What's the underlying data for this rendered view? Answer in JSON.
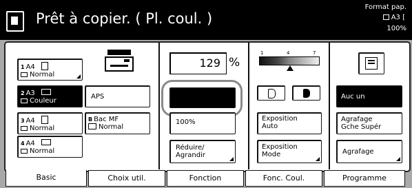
{
  "header": {
    "title": "Prêt à copier. ( Pl. coul.   )",
    "format_label": "Format pap.",
    "format_size": "A3  [",
    "zoom": "100%"
  },
  "paper": [
    {
      "num": "1",
      "size": "A4",
      "type": "Normal"
    },
    {
      "num": "2",
      "size": "A3",
      "type": "Couleur"
    },
    {
      "num": "3",
      "size": "A4",
      "type": "Normal"
    },
    {
      "num": "4",
      "size": "A4",
      "type": "Normal"
    }
  ],
  "aps_label": "APS",
  "bypass": {
    "num": "B",
    "label": "Bac MF",
    "type": "Normal"
  },
  "zoom_panel": {
    "value": "129",
    "unit": "%",
    "preset": "100%",
    "reduce_label_1": "Réduire/",
    "reduce_label_2": "Agrandir"
  },
  "exposure": {
    "scale_marks": [
      "1",
      "4",
      "7"
    ],
    "auto_label_1": "Exposition",
    "auto_label_2": "Auto",
    "mode_label_1": "Exposition",
    "mode_label_2": "Mode"
  },
  "finish": {
    "none_label": "Auc un",
    "staple_label_1": "Agrafage",
    "staple_label_2": "Gche Supér",
    "staple_btn": "Agrafage"
  },
  "tabs": [
    "Basic",
    "Choix util.",
    "Fonction",
    "Fonc. Coul.",
    "Programme"
  ]
}
